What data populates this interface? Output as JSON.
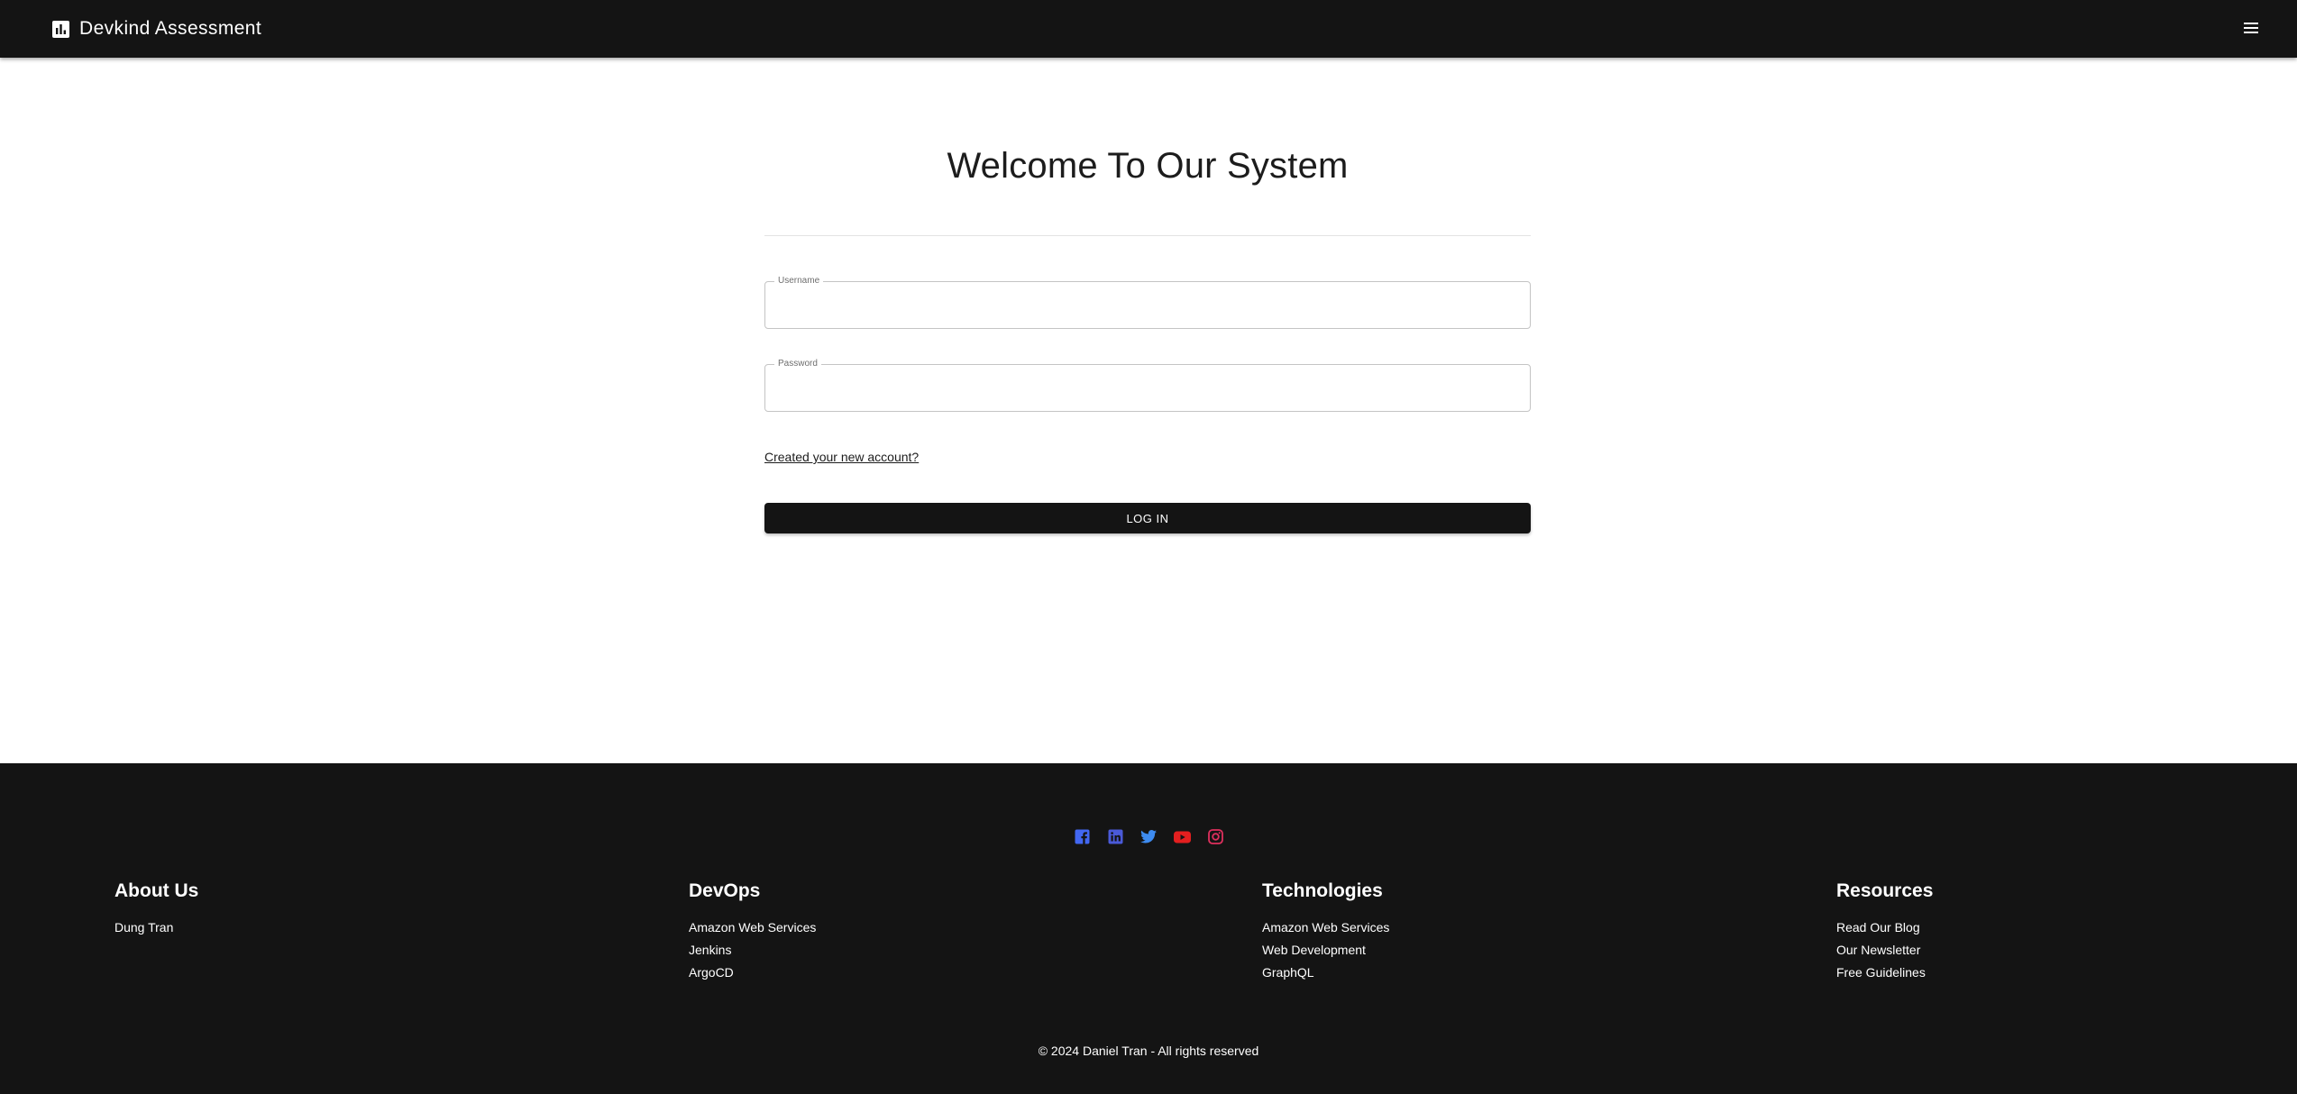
{
  "header": {
    "brand_icon": "bar-chart-icon",
    "brand_title": "Devkind Assessment",
    "menu_icon": "hamburger-menu-icon",
    "background": "#141414"
  },
  "login": {
    "title": "Welcome To Our System",
    "username": {
      "label": "Username",
      "value": ""
    },
    "password": {
      "label": "Password",
      "value": ""
    },
    "signup_link": "Created your new account?",
    "login_button": "LOG IN",
    "button_color": "#141414"
  },
  "footer": {
    "background": "#141414",
    "social": [
      {
        "icon": "facebook-icon",
        "color": "#4267f2"
      },
      {
        "icon": "linkedin-icon",
        "color": "#4a5ad8"
      },
      {
        "icon": "twitter-icon",
        "color": "#3d8bf0"
      },
      {
        "icon": "youtube-icon",
        "color": "#e31f1f"
      },
      {
        "icon": "instagram-icon",
        "color": "#e0305e"
      }
    ],
    "columns": [
      {
        "heading": "About Us",
        "links": [
          "Dung Tran"
        ]
      },
      {
        "heading": "DevOps",
        "links": [
          "Amazon Web Services",
          "Jenkins",
          "ArgoCD"
        ]
      },
      {
        "heading": "Technologies",
        "links": [
          "Amazon Web Services",
          "Web Development",
          "GraphQL"
        ]
      },
      {
        "heading": "Resources",
        "links": [
          "Read Our Blog",
          "Our Newsletter",
          "Free Guidelines"
        ]
      }
    ],
    "copyright": "© 2024 Daniel Tran - All rights reserved"
  }
}
